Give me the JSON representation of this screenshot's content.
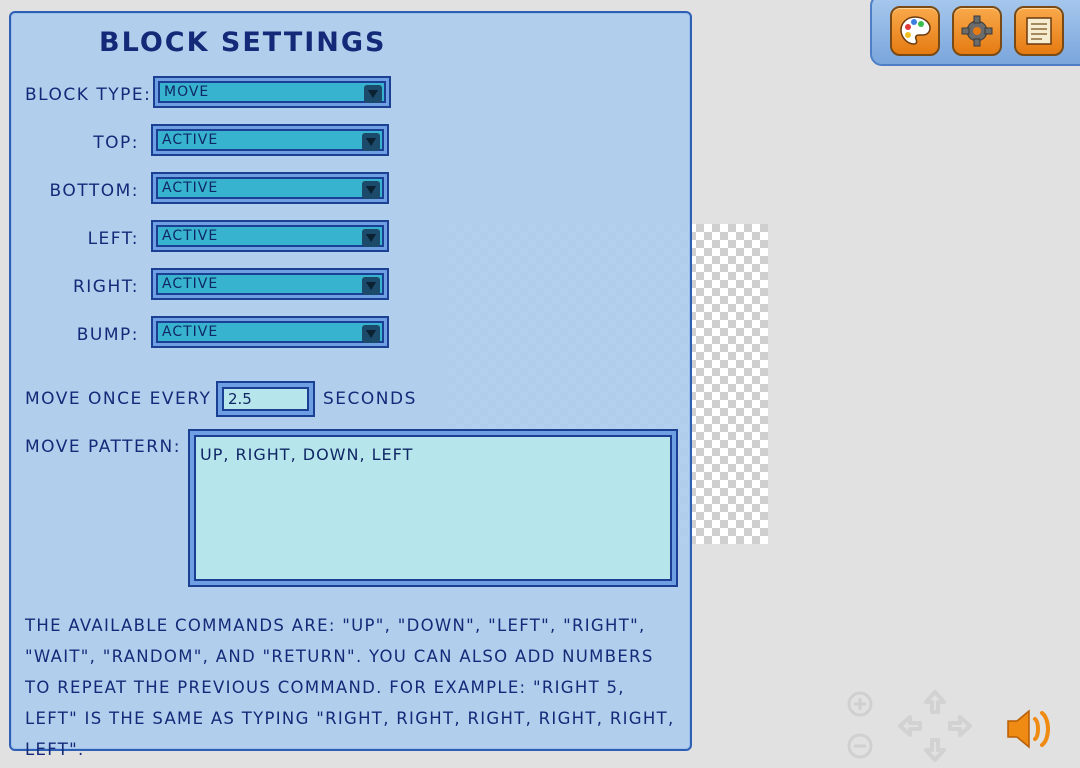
{
  "panel": {
    "title": "Block Settings",
    "block_type": {
      "label": "Block Type:",
      "value": "Move"
    },
    "top": {
      "label": "Top:",
      "value": "Active"
    },
    "bottom": {
      "label": "Bottom:",
      "value": "Active"
    },
    "left": {
      "label": "Left:",
      "value": "Active"
    },
    "right": {
      "label": "Right:",
      "value": "Active"
    },
    "bump": {
      "label": "Bump:",
      "value": "Active"
    },
    "move_once_every": {
      "label": "Move once every",
      "value": "2.5",
      "unit": "seconds"
    },
    "move_pattern": {
      "label": "Move pattern:",
      "value": "up, right, down, left"
    },
    "help_text": "The available commands are: \"up\", \"down\", \"left\", \"right\", \"wait\", \"random\", and \"return\". You can also add numbers to repeat the previous command. For example: \"right 5, left\" is the same as typing \"right, right, right, right, right, left\"."
  },
  "toolbar": {
    "icons": [
      "palette-icon",
      "gear-icon",
      "notes-icon"
    ]
  },
  "controls": {
    "icons": [
      "zoom-in-icon",
      "zoom-out-icon",
      "pan-arrows-icon",
      "sound-icon"
    ]
  },
  "colors": {
    "accent": "#e57b12",
    "panel": "#adcdee",
    "select": "#38b3cf"
  }
}
